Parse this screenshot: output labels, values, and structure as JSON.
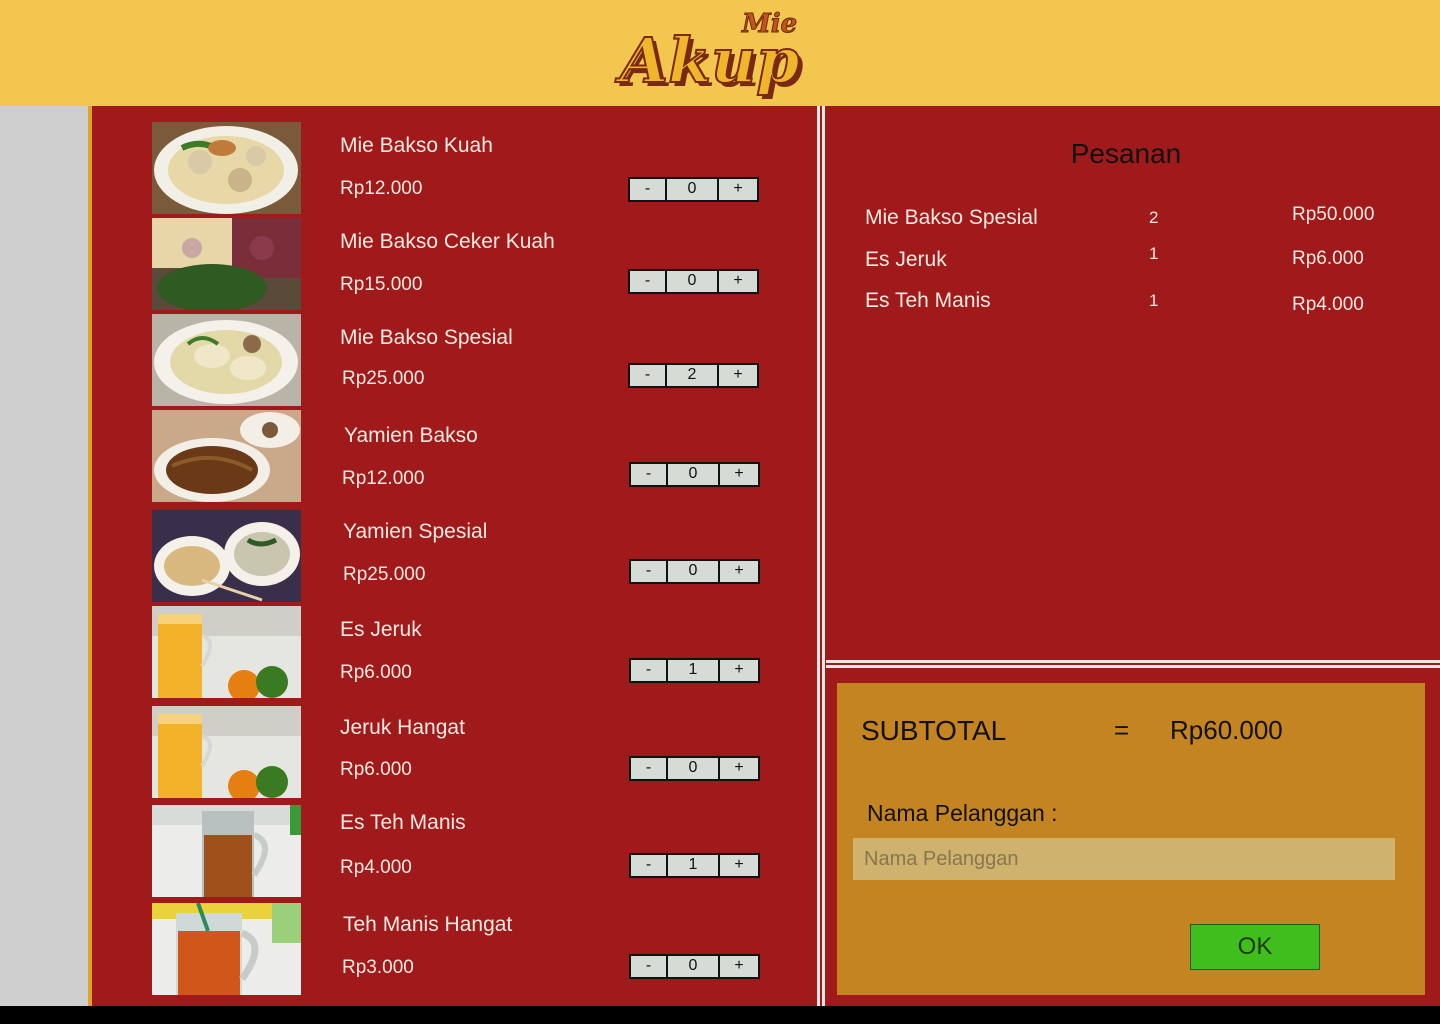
{
  "header": {
    "logo_top": "Mie",
    "logo_main": "Akup"
  },
  "menu": {
    "items": [
      {
        "name": "Mie Bakso Kuah",
        "price": "Rp12.000",
        "qty": "0",
        "image": "bakso-kuah-photo"
      },
      {
        "name": "Mie Bakso Ceker Kuah",
        "price": "Rp15.000",
        "qty": "0",
        "image": "bakso-ceker-photo"
      },
      {
        "name": "Mie Bakso Spesial",
        "price": "Rp25.000",
        "qty": "2",
        "image": "bakso-spesial-photo"
      },
      {
        "name": "Yamien Bakso",
        "price": "Rp12.000",
        "qty": "0",
        "image": "yamien-bakso-photo"
      },
      {
        "name": "Yamien Spesial",
        "price": "Rp25.000",
        "qty": "0",
        "image": "yamien-spesial-photo"
      },
      {
        "name": "Es Jeruk",
        "price": "Rp6.000",
        "qty": "1",
        "image": "es-jeruk-photo"
      },
      {
        "name": "Jeruk Hangat",
        "price": "Rp6.000",
        "qty": "0",
        "image": "jeruk-hangat-photo"
      },
      {
        "name": "Es Teh Manis",
        "price": "Rp4.000",
        "qty": "1",
        "image": "es-teh-photo"
      },
      {
        "name": "Teh Manis Hangat",
        "price": "Rp3.000",
        "qty": "0",
        "image": "teh-hangat-photo"
      }
    ],
    "minus_label": "-",
    "plus_label": "+"
  },
  "order": {
    "title": "Pesanan",
    "rows": [
      {
        "name": "Mie Bakso Spesial",
        "qty": "2",
        "price": "Rp50.000"
      },
      {
        "name": "Es Jeruk",
        "qty": "1",
        "price": "Rp6.000"
      },
      {
        "name": "Es Teh Manis",
        "qty": "1",
        "price": "Rp4.000"
      }
    ]
  },
  "summary": {
    "subtotal_label": "SUBTOTAL",
    "equals": "=",
    "subtotal_value": "Rp60.000",
    "customer_label": "Nama Pelanggan :",
    "customer_placeholder": "Nama Pelanggan",
    "customer_value": "",
    "ok_label": "OK"
  },
  "colors": {
    "header": "#f3c74f",
    "panel": "#a01a1c",
    "summary": "#c38421",
    "ok": "#3fbe1e"
  }
}
